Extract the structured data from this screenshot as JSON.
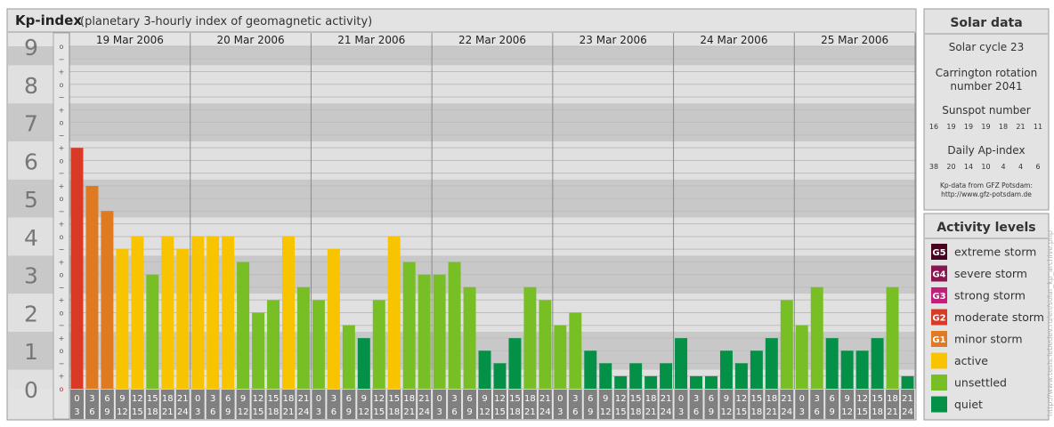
{
  "header": {
    "title": "Kp-index",
    "subtitle": "(planetary 3-hourly index of geomagnetic activity)"
  },
  "chart_data": {
    "type": "bar",
    "title": "Kp-index",
    "subtitle": "(planetary 3-hourly index of geomagnetic activity)",
    "ylim": [
      0,
      9
    ],
    "y_ticks": [
      "0",
      "1",
      "2",
      "3",
      "4",
      "5",
      "6",
      "7",
      "8",
      "9"
    ],
    "subdivision_marks": [
      "o",
      "+",
      "−",
      "o",
      "+",
      "−",
      "o",
      "+",
      "−",
      "o",
      "+",
      "−",
      "o",
      "+",
      "−",
      "o",
      "+",
      "−",
      "o",
      "+",
      "−",
      "o",
      "+",
      "−",
      "o",
      "+",
      "−",
      "o"
    ],
    "days": [
      "19 Mar 2006",
      "20 Mar 2006",
      "21 Mar 2006",
      "22 Mar 2006",
      "23 Mar 2006",
      "24 Mar 2006",
      "25 Mar 2006"
    ],
    "interval_labels": [
      [
        "0",
        "3"
      ],
      [
        "3",
        "6"
      ],
      [
        "6",
        "9"
      ],
      [
        "9",
        "12"
      ],
      [
        "12",
        "15"
      ],
      [
        "15",
        "18"
      ],
      [
        "18",
        "21"
      ],
      [
        "21",
        "24"
      ]
    ],
    "values": [
      6.33,
      5.33,
      4.67,
      3.67,
      4.0,
      3.0,
      4.0,
      3.67,
      4.0,
      4.0,
      4.0,
      3.33,
      2.0,
      2.33,
      4.0,
      2.67,
      2.33,
      3.67,
      1.67,
      1.33,
      2.33,
      4.0,
      3.33,
      3.0,
      3.0,
      3.33,
      2.67,
      1.0,
      0.67,
      1.33,
      2.67,
      2.33,
      1.67,
      2.0,
      1.0,
      0.67,
      0.33,
      0.67,
      0.33,
      0.67,
      1.33,
      0.33,
      0.33,
      1.0,
      0.67,
      1.0,
      1.33,
      2.33,
      1.67,
      2.67,
      1.33,
      1.0,
      1.0,
      1.33,
      2.67,
      0.33
    ],
    "grid": true,
    "legend_placement": "right"
  },
  "solar": {
    "title": "Solar data",
    "cycle": "Solar cycle 23",
    "carrington_line1": "Carrington rotation",
    "carrington_line2": "number 2041",
    "sunspot_title": "Sunspot number",
    "sunspot_values": [
      "16",
      "19",
      "19",
      "19",
      "18",
      "21",
      "11"
    ],
    "ap_title": "Daily Ap-index",
    "ap_values": [
      "38",
      "20",
      "14",
      "10",
      "4",
      "4",
      "6"
    ],
    "source_line1": "Kp-data from GFZ Potsdam:",
    "source_line2": "http://www.gfz-potsdam.de"
  },
  "activity": {
    "title": "Activity levels",
    "items": [
      {
        "badge": "G5",
        "label": "extreme storm",
        "color": "#4a0020"
      },
      {
        "badge": "G4",
        "label": "severe storm",
        "color": "#8a1550"
      },
      {
        "badge": "G3",
        "label": "strong storm",
        "color": "#c0207a"
      },
      {
        "badge": "G2",
        "label": "moderate storm",
        "color": "#d83a25"
      },
      {
        "badge": "G1",
        "label": "minor storm",
        "color": "#e07a20"
      },
      {
        "badge": "",
        "label": "active",
        "color": "#f8c400"
      },
      {
        "badge": "",
        "label": "unsettled",
        "color": "#77bf24"
      },
      {
        "badge": "",
        "label": "quiet",
        "color": "#059048"
      }
    ]
  },
  "watermark": "http://www.tesis.lebedev.ru/en/solar_kp_archive.php",
  "colors": {
    "kp_ge_9": "#4a0020",
    "kp_8": "#8a1550",
    "kp_7": "#c0207a",
    "kp_6": "#d83a25",
    "kp_5": "#e07a20",
    "kp_4": "#f8c400",
    "kp_2_3": "#77bf24",
    "kp_0_1": "#059048",
    "panel_bg": "#e3e3e3",
    "band_dark": "#c8c8c8",
    "band_light": "#e0e0e0"
  }
}
